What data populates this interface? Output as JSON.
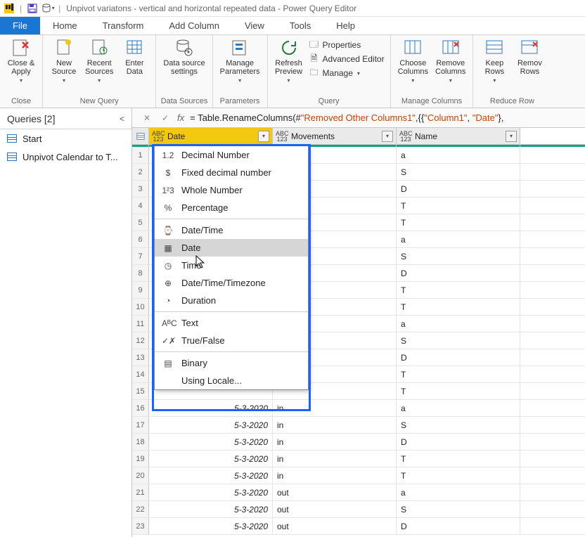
{
  "titlebar": {
    "title": "Unpivot variatons  - vertical and horizontal repeated data - Power Query Editor"
  },
  "tabs": {
    "file": "File",
    "home": "Home",
    "transform": "Transform",
    "addcol": "Add Column",
    "view": "View",
    "tools": "Tools",
    "help": "Help"
  },
  "ribbon": {
    "close": {
      "btn": "Close &\nApply",
      "group": "Close"
    },
    "newquery": {
      "new": "New\nSource",
      "recent": "Recent\nSources",
      "enter": "Enter\nData",
      "group": "New Query"
    },
    "datasources": {
      "btn": "Data source\nsettings",
      "group": "Data Sources"
    },
    "parameters": {
      "btn": "Manage\nParameters",
      "group": "Parameters"
    },
    "query": {
      "refresh": "Refresh\nPreview",
      "props": "Properties",
      "adv": "Advanced Editor",
      "manage": "Manage",
      "group": "Query"
    },
    "managecols": {
      "choose": "Choose\nColumns",
      "remove": "Remove\nColumns",
      "group": "Manage Columns"
    },
    "reducerows": {
      "keep": "Keep\nRows",
      "remove": "Remov\nRows",
      "group": "Reduce Row"
    }
  },
  "queries": {
    "header": "Queries [2]",
    "items": [
      {
        "label": "Start"
      },
      {
        "label": "Unpivot Calendar to T..."
      }
    ]
  },
  "formula": {
    "pre": "= Table.RenameColumns(#",
    "s1": "\"Removed Other Columns1\"",
    "mid": ",{{",
    "s2": "\"Column1\"",
    "mid2": ", ",
    "s3": "\"Date\"",
    "post": "},"
  },
  "columns": {
    "date": "Date",
    "movements": "Movements",
    "name": "Name"
  },
  "type_menu": [
    {
      "icon": "1.2",
      "label": "Decimal Number"
    },
    {
      "icon": "$",
      "label": "Fixed decimal number"
    },
    {
      "icon": "1²3",
      "label": "Whole Number"
    },
    {
      "icon": "%",
      "label": "Percentage"
    },
    {
      "sep": true
    },
    {
      "icon": "⌚",
      "label": "Date/Time"
    },
    {
      "icon": "▦",
      "label": "Date",
      "hover": true
    },
    {
      "icon": "◷",
      "label": "Time"
    },
    {
      "icon": "⊕",
      "label": "Date/Time/Timezone"
    },
    {
      "icon": "◔",
      "label": "Duration"
    },
    {
      "sep": true
    },
    {
      "icon": "AᴮC",
      "label": "Text"
    },
    {
      "icon": "✓✗",
      "label": "True/False"
    },
    {
      "sep": true
    },
    {
      "icon": "▤",
      "label": "Binary"
    },
    {
      "icon": "",
      "label": "Using Locale..."
    }
  ],
  "rows": [
    {
      "n": 1,
      "name": "a"
    },
    {
      "n": 2,
      "name": "S"
    },
    {
      "n": 3,
      "name": "D"
    },
    {
      "n": 4,
      "name": "T"
    },
    {
      "n": 5,
      "name": "T"
    },
    {
      "n": 6,
      "name": "a"
    },
    {
      "n": 7,
      "name": "S"
    },
    {
      "n": 8,
      "name": "D"
    },
    {
      "n": 9,
      "name": "T"
    },
    {
      "n": 10,
      "name": "T"
    },
    {
      "n": 11,
      "name": "a"
    },
    {
      "n": 12,
      "name": "S"
    },
    {
      "n": 13,
      "name": "D"
    },
    {
      "n": 14,
      "name": "T"
    },
    {
      "n": 15,
      "name": "T"
    },
    {
      "n": 16,
      "date": "5-3-2020",
      "mov": "in",
      "name": "a"
    },
    {
      "n": 17,
      "date": "5-3-2020",
      "mov": "in",
      "name": "S"
    },
    {
      "n": 18,
      "date": "5-3-2020",
      "mov": "in",
      "name": "D"
    },
    {
      "n": 19,
      "date": "5-3-2020",
      "mov": "in",
      "name": "T"
    },
    {
      "n": 20,
      "date": "5-3-2020",
      "mov": "in",
      "name": "T"
    },
    {
      "n": 21,
      "date": "5-3-2020",
      "mov": "out",
      "name": "a"
    },
    {
      "n": 22,
      "date": "5-3-2020",
      "mov": "out",
      "name": "S"
    },
    {
      "n": 23,
      "date": "5-3-2020",
      "mov": "out",
      "name": "D"
    }
  ],
  "type_prefix": "ABC\n123"
}
